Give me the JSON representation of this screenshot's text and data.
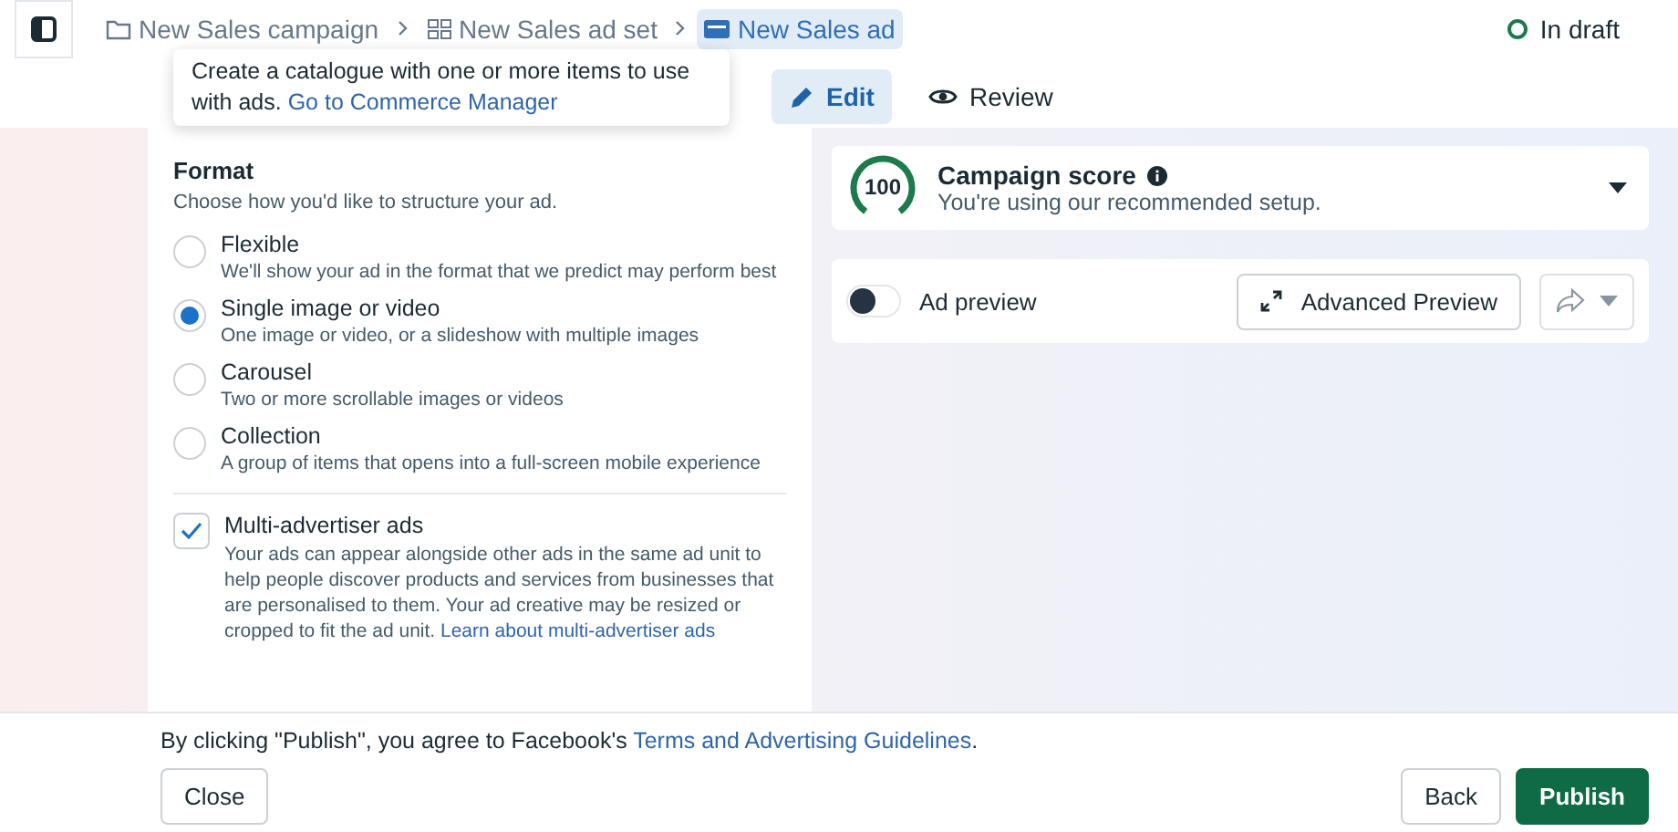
{
  "breadcrumbs": [
    {
      "kind": "campaign",
      "label": "New Sales campaign",
      "selected": false
    },
    {
      "kind": "adset",
      "label": "New Sales ad set",
      "selected": false
    },
    {
      "kind": "ad",
      "label": "New Sales ad",
      "selected": true
    }
  ],
  "status": "In draft",
  "tooltip": {
    "text": "Create a catalogue with one or more items to use with ads.",
    "link": "Go to Commerce Manager"
  },
  "tabs": [
    {
      "kind": "edit",
      "label": "Edit",
      "selected": true
    },
    {
      "kind": "review",
      "label": "Review",
      "selected": false
    }
  ],
  "format": {
    "title": "Format",
    "subtitle": "Choose how you'd like to structure your ad.",
    "options": [
      {
        "label": "Flexible",
        "description": "We'll show your ad in the format that we predict may perform best",
        "selected": false
      },
      {
        "label": "Single image or video",
        "description": "One image or video, or a slideshow with multiple images",
        "selected": true
      },
      {
        "label": "Carousel",
        "description": "Two or more scrollable images or videos",
        "selected": false
      },
      {
        "label": "Collection",
        "description": "A group of items that opens into a full-screen mobile experience",
        "selected": false
      }
    ],
    "multi_advertiser": {
      "label": "Multi-advertiser ads",
      "checked": true,
      "description": "Your ads can appear alongside other ads in the same ad unit to help people discover products and services from businesses that are personalised to them. Your ad creative may be resized or cropped to fit the ad unit.",
      "link": "Learn about multi-advertiser ads"
    }
  },
  "campaign_score": {
    "score": "100",
    "title": "Campaign score",
    "subtitle": "You're using our recommended setup."
  },
  "ad_preview": {
    "label": "Ad preview",
    "on": false,
    "button": "Advanced Preview"
  },
  "footer": {
    "text": "By clicking \"Publish\", you agree to Facebook's",
    "link": "Terms and Advertising Guidelines",
    "end": ".",
    "buttons": [
      {
        "kind": "secondary",
        "label": "Close"
      },
      {
        "kind": "secondary",
        "label": "Back"
      },
      {
        "kind": "primary",
        "label": "Publish"
      }
    ]
  }
}
